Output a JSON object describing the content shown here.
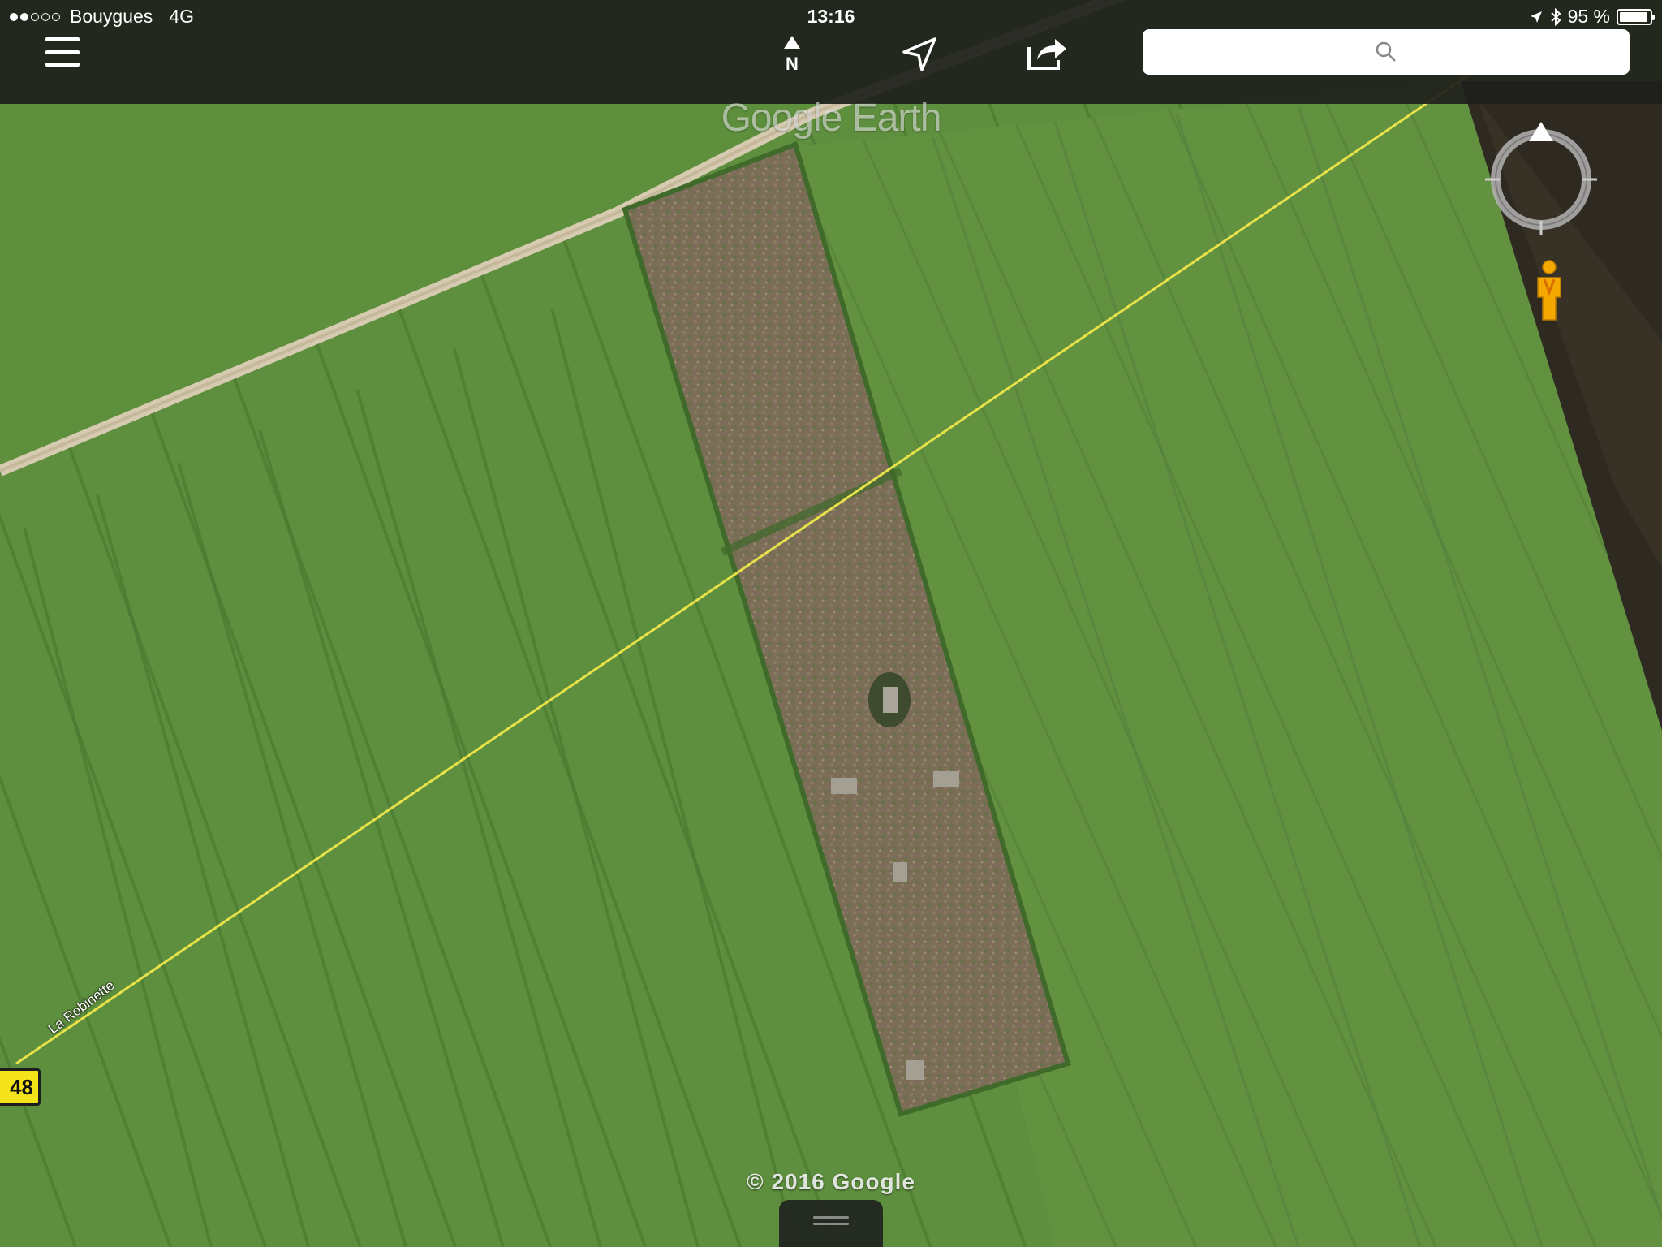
{
  "status_bar": {
    "carrier": "Bouygues",
    "network": "4G",
    "signal_bars_filled": 2,
    "signal_bars_total": 5,
    "time": "13:16",
    "battery_percent_label": "95 %",
    "battery_level": 0.95
  },
  "toolbar": {
    "menu_icon": "hamburger-menu-icon",
    "north_label": "N",
    "north_icon": "north-arrow-icon",
    "locate_icon": "location-arrow-icon",
    "share_icon": "share-icon",
    "search_placeholder": "",
    "search_icon": "magnifier-icon"
  },
  "map": {
    "watermark": "Google Earth",
    "copyright": "© 2016 Google",
    "road_label": "La Robinette",
    "route_shield": "48",
    "colors": {
      "field": "#5e8f3e",
      "field_dark": "#4f7d33",
      "heath": "#7a6a55",
      "road": "#d8cdb3",
      "route_line": "#e8e24a",
      "toolbar": "#1e201c"
    }
  },
  "controls": {
    "compass_icon": "compass-ring-icon",
    "pegman_icon": "pegman-icon",
    "drawer_icon": "drawer-handle-icon"
  }
}
